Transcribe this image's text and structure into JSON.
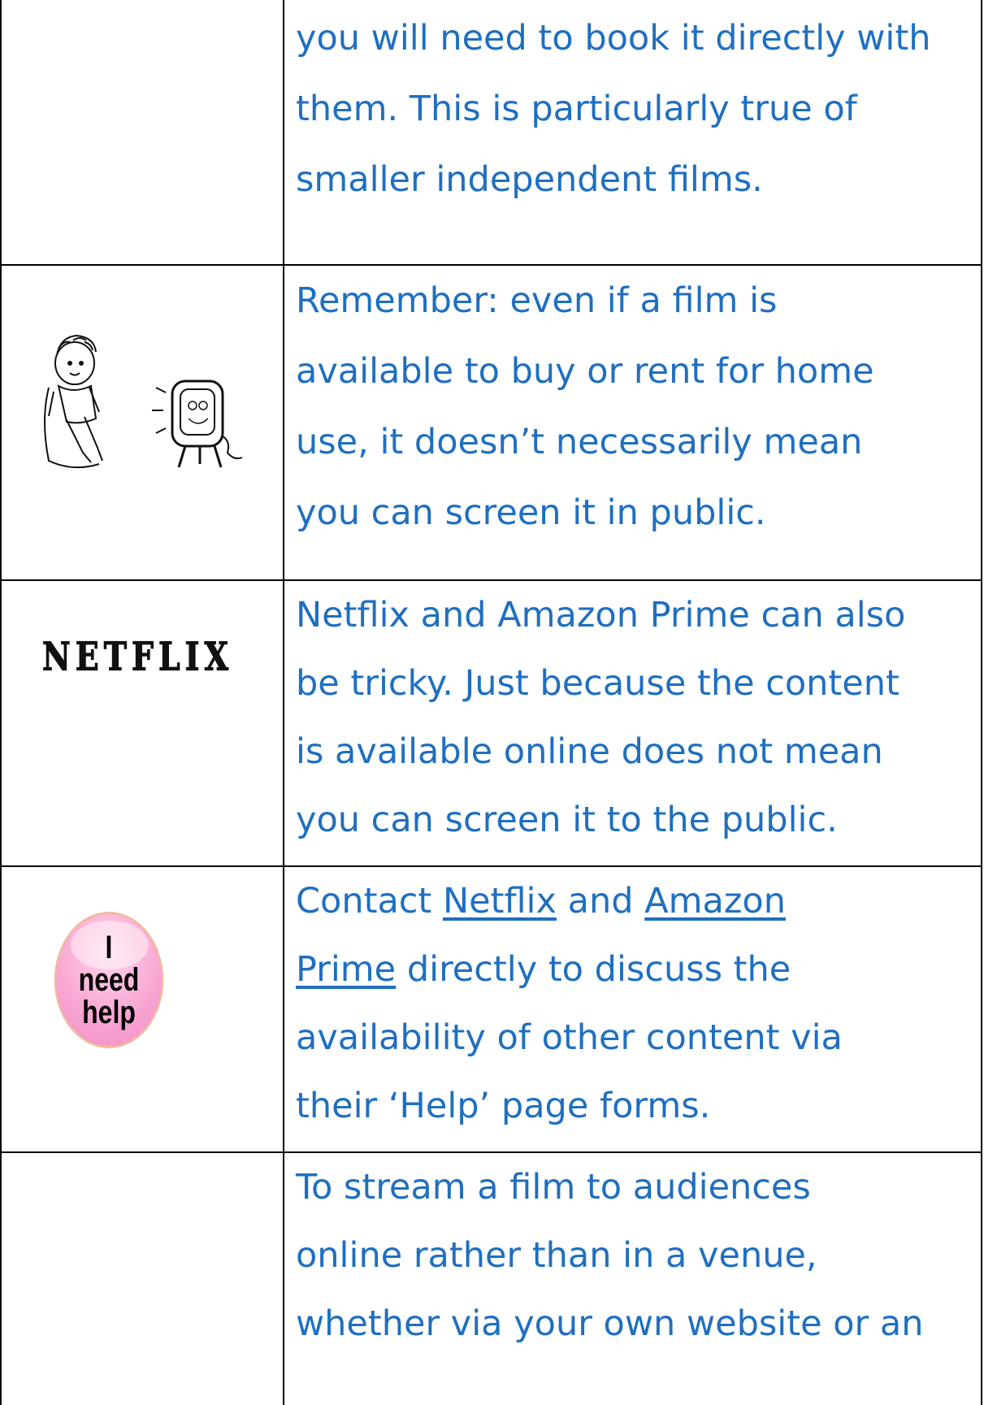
{
  "rows": [
    {
      "lines": [
        "you will need to book it directly with",
        "them. This is particularly true of",
        "smaller independent films."
      ]
    },
    {
      "icon": "person-watching-tv-illustration",
      "lines": [
        "Remember: even if a film is",
        "available to buy or rent for home",
        "use, it doesn’t necessarily mean",
        "you can screen it in public."
      ]
    },
    {
      "logo_text": "NETFLIX",
      "lines": [
        "Netflix and Amazon Prime can also",
        "be tricky. Just because the content",
        "is available online does not mean",
        "you can screen it to the public."
      ]
    },
    {
      "button": {
        "word1": "I",
        "word2": "need",
        "word3": "help"
      },
      "line1_prefix": "Contact ",
      "link_netflix": "Netflix",
      "line1_mid": " and ",
      "link_amazon_part1": "Amazon",
      "link_amazon_part2": "Prime",
      "line2_suffix": " directly to discuss the",
      "line3": "availability of other content via",
      "line4": "their ‘Help’ page forms."
    },
    {
      "lines": [
        "To stream a film to audiences",
        "online rather than in a venue,",
        "whether via your own website or an"
      ]
    }
  ],
  "colors": {
    "text": "#1f6fc0",
    "border": "#000000",
    "help_button": "#f9a8d4"
  }
}
